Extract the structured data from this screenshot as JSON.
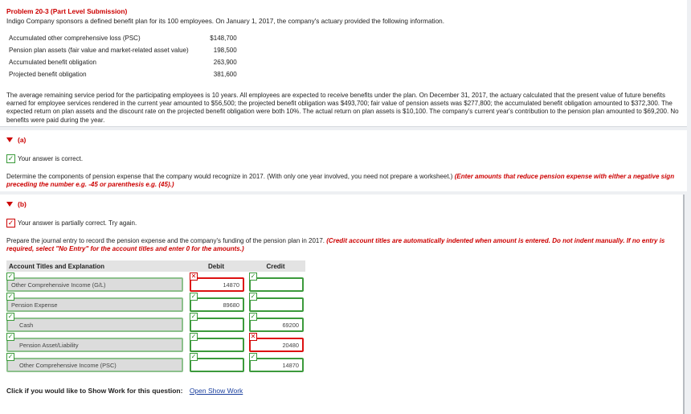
{
  "problem": {
    "title": "Problem 20-3 (Part Level Submission)",
    "intro": "Indigo Company sponsors a defined benefit plan for its 100 employees. On January 1, 2017, the company's actuary provided the following information.",
    "info_rows": [
      {
        "label": "Accumulated other comprehensive loss (PSC)",
        "amount": "$148,700"
      },
      {
        "label": "Pension plan assets (fair value and market-related asset value)",
        "amount": "198,500"
      },
      {
        "label": "Accumulated benefit obligation",
        "amount": "263,900"
      },
      {
        "label": "Projected benefit obligation",
        "amount": "381,600"
      }
    ],
    "paragraph": "The average remaining service period for the participating employees is 10 years. All employees are expected to receive benefits under the plan. On December 31, 2017, the actuary calculated that the present value of future benefits earned for employee services rendered in the current year amounted to $56,500; the projected benefit obligation was $493,700; fair value of pension assets was $277,800; the accumulated benefit obligation amounted to $372,300. The expected return on plan assets and the discount rate on the projected benefit obligation were both 10%. The actual return on plan assets is $10,100. The company's current year's contribution to the pension plan amounted to $69,200. No benefits were paid during the year."
  },
  "part_a": {
    "label": "(a)",
    "status": "Your answer is correct.",
    "instruction": "Determine the components of pension expense that the company would recognize in 2017. (With only one year involved, you need not prepare a worksheet.)",
    "instruction_red": "(Enter amounts that reduce pension expense with either a negative sign preceding the number e.g. -45 or parenthesis e.g. (45).)"
  },
  "part_b": {
    "label": "(b)",
    "status": "Your answer is partially correct.  Try again.",
    "instruction": "Prepare the journal entry to record the pension expense and the company's funding of the pension plan in 2017.",
    "instruction_red": "(Credit account titles are automatically indented when amount is entered. Do not indent manually. If no entry is required, select \"No Entry\" for the account titles and enter 0 for the amounts.)",
    "table_headers": {
      "account": "Account Titles and Explanation",
      "debit": "Debit",
      "credit": "Credit"
    },
    "rows": [
      {
        "account": "Other Comprehensive Income (G/L)",
        "debit": "14870",
        "credit": "",
        "acct_ok": true,
        "debit_ok": false,
        "credit_ok": true,
        "indent": false
      },
      {
        "account": "Pension Expense",
        "debit": "89680",
        "credit": "",
        "acct_ok": true,
        "debit_ok": true,
        "credit_ok": true,
        "indent": false
      },
      {
        "account": "Cash",
        "debit": "",
        "credit": "69200",
        "acct_ok": true,
        "debit_ok": true,
        "credit_ok": true,
        "indent": true
      },
      {
        "account": "Pension Asset/Liability",
        "debit": "",
        "credit": "20480",
        "acct_ok": true,
        "debit_ok": true,
        "credit_ok": false,
        "indent": true
      },
      {
        "account": "Other Comprehensive Income (PSC)",
        "debit": "",
        "credit": "14870",
        "acct_ok": true,
        "debit_ok": true,
        "credit_ok": true,
        "indent": true
      }
    ],
    "show_work_text": "Click if you would like to Show Work for this question:",
    "show_work_link": "Open Show Work"
  },
  "colors": {
    "accent_red": "#cc0000",
    "correct_green": "#3c9a3c",
    "link_blue": "#1a3f9e"
  }
}
